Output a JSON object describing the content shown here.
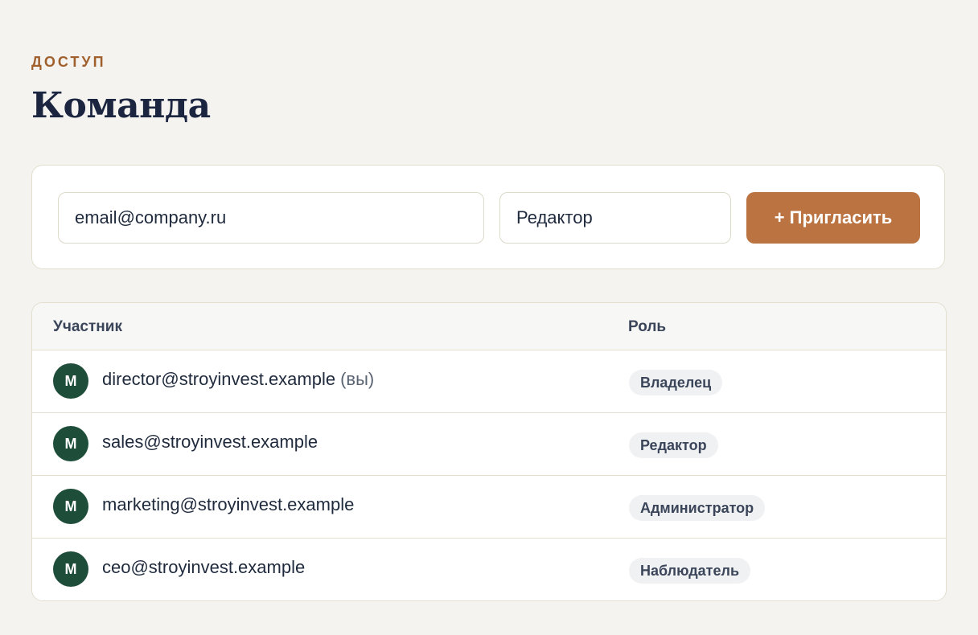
{
  "page": {
    "eyebrow": "ДОСТУП",
    "title": "Команда"
  },
  "invite": {
    "email_value": "email@company.ru",
    "role_value": "Редактор",
    "button_label": "+ Пригласить"
  },
  "table": {
    "headers": {
      "member": "Участник",
      "role": "Роль"
    },
    "rows": [
      {
        "avatar": "M",
        "email": "director@stroyinvest.example",
        "suffix": "(вы)",
        "role": "Владелец"
      },
      {
        "avatar": "M",
        "email": "sales@stroyinvest.example",
        "suffix": "",
        "role": "Редактор"
      },
      {
        "avatar": "M",
        "email": "marketing@stroyinvest.example",
        "suffix": "",
        "role": "Администратор"
      },
      {
        "avatar": "M",
        "email": "ceo@stroyinvest.example",
        "suffix": "",
        "role": "Наблюдатель"
      }
    ]
  },
  "colors": {
    "background": "#f4f3ef",
    "accent": "#bb7441",
    "eyebrow": "#a0602d",
    "avatar": "#1e4d3a",
    "title": "#1b2540"
  }
}
